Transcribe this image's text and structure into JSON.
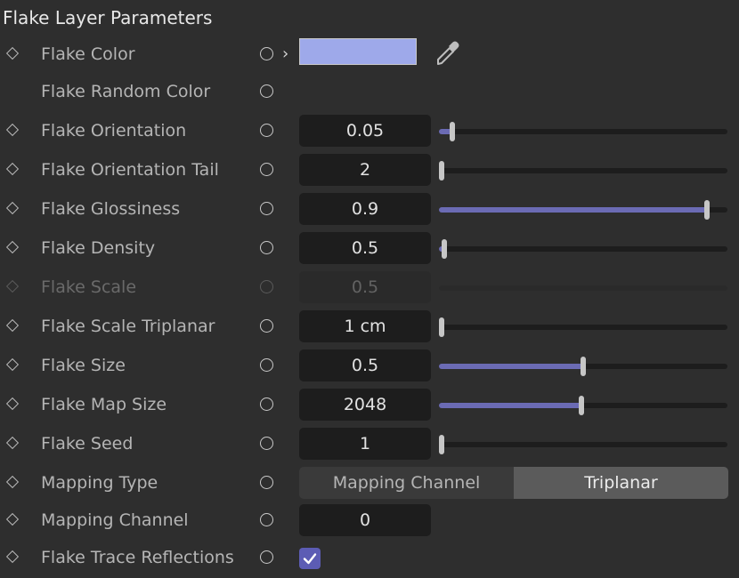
{
  "panel": {
    "title": "Flake Layer Parameters",
    "accent_color": "#6b6bb4",
    "flake_color_swatch": "#9ea9ea"
  },
  "rows": {
    "flake_color": {
      "label": "Flake Color"
    },
    "flake_random_color": {
      "label": "Flake Random Color"
    },
    "flake_orientation": {
      "label": "Flake Orientation",
      "value": "0.05",
      "slider_fraction": 0.045
    },
    "flake_orientation_tail": {
      "label": "Flake Orientation Tail",
      "value": "2",
      "slider_fraction": 0.01
    },
    "flake_glossiness": {
      "label": "Flake Glossiness",
      "value": "0.9",
      "slider_fraction": 0.93
    },
    "flake_density": {
      "label": "Flake Density",
      "value": "0.5",
      "slider_fraction": 0.02
    },
    "flake_scale": {
      "label": "Flake Scale",
      "value": "0.5",
      "disabled": true
    },
    "flake_scale_triplanar": {
      "label": "Flake Scale Triplanar",
      "value": "1 cm",
      "slider_fraction": 0.01
    },
    "flake_size": {
      "label": "Flake Size",
      "value": "0.5",
      "slider_fraction": 0.5
    },
    "flake_map_size": {
      "label": "Flake Map Size",
      "value": "2048",
      "slider_fraction": 0.495
    },
    "flake_seed": {
      "label": "Flake Seed",
      "value": "1",
      "slider_fraction": 0.01
    },
    "mapping_type": {
      "label": "Mapping Type",
      "options": [
        "Mapping Channel",
        "Triplanar"
      ],
      "selected": "Triplanar"
    },
    "mapping_channel": {
      "label": "Mapping Channel",
      "value": "0"
    },
    "flake_trace_reflections": {
      "label": "Flake Trace Reflections",
      "checked": true
    }
  },
  "icons": {
    "keyframe": "diamond-icon",
    "animation": "circle-icon",
    "expand": "chevron-right-icon",
    "color_pick": "eyedropper-icon",
    "checkbox": "checkmark-icon"
  }
}
